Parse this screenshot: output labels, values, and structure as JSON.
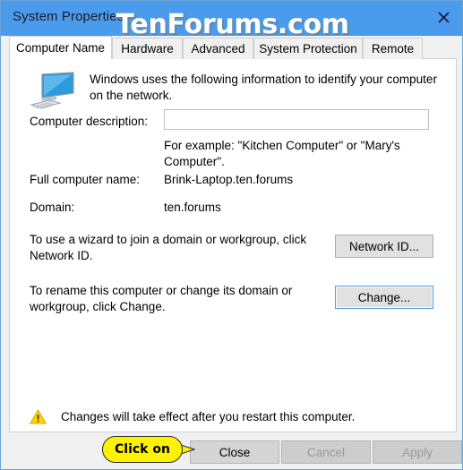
{
  "window": {
    "title": "System Properties",
    "close_icon": "close-icon",
    "accent_color": "#4a9beb",
    "titlebar_color": "#4a9beb"
  },
  "watermark": {
    "text": "TenForums.com"
  },
  "tabs": [
    {
      "label": "Computer Name",
      "selected": true
    },
    {
      "label": "Hardware",
      "selected": false
    },
    {
      "label": "Advanced",
      "selected": false
    },
    {
      "label": "System Protection",
      "selected": false
    },
    {
      "label": "Remote",
      "selected": false
    }
  ],
  "panel": {
    "icon": "computer-monitor-icon",
    "intro": "Windows uses the following information to identify your computer on the network.",
    "computer_description": {
      "label": "Computer description:",
      "value": "",
      "placeholder": "",
      "example": "For example: \"Kitchen Computer\" or \"Mary's Computer\"."
    },
    "full_computer_name": {
      "label": "Full computer name:",
      "value": "Brink-Laptop.ten.forums"
    },
    "domain": {
      "label": "Domain:",
      "value": "ten.forums"
    },
    "network_id": {
      "text": "To use a wizard to join a domain or workgroup, click Network ID.",
      "button": "Network ID..."
    },
    "rename": {
      "text": "To rename this computer or change its domain or workgroup, click Change.",
      "button": "Change..."
    },
    "warning": {
      "icon": "warning-triangle-icon",
      "text": "Changes will take effect after you restart this computer.",
      "icon_color": "#ffd400"
    }
  },
  "footer": {
    "close": "Close",
    "cancel": "Cancel",
    "apply": "Apply",
    "cancel_disabled": true,
    "apply_disabled": true
  },
  "callout": {
    "text": "Click on",
    "color": "#fff200"
  }
}
